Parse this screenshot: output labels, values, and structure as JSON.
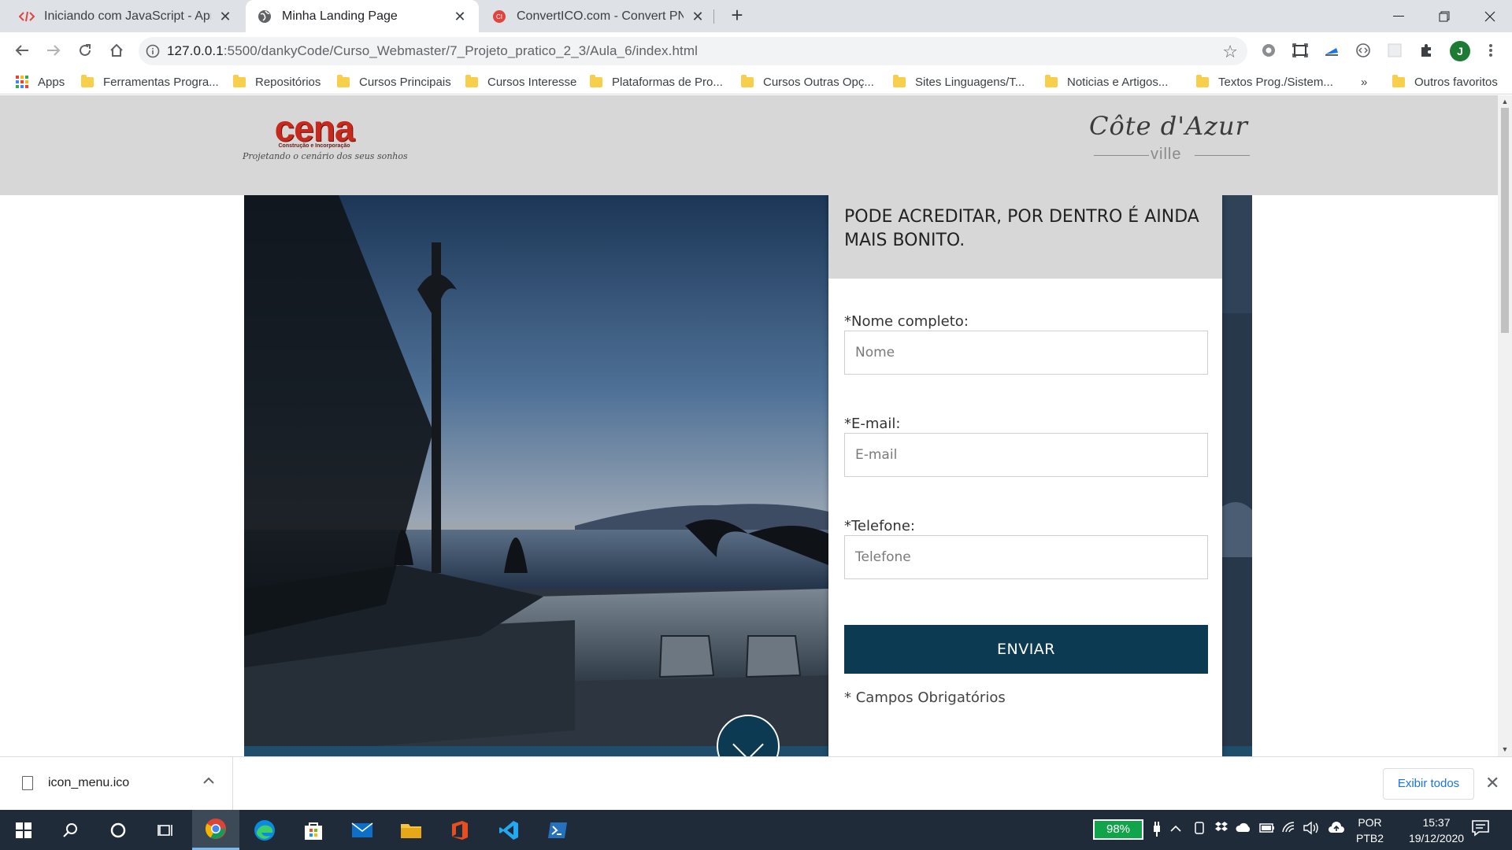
{
  "browser": {
    "tabs": [
      {
        "title": "Iniciando com JavaScript - Apres",
        "active": false
      },
      {
        "title": "Minha Landing Page",
        "active": true
      },
      {
        "title": "ConvertICO.com - Convert PNG t",
        "active": false
      }
    ],
    "new_tab_label": "+",
    "url": {
      "host": "127.0.0.1",
      "path": ":5500/dankyCode/Curso_Webmaster/7_Projeto_pratico_2_3/Aula_6/index.html"
    },
    "profile_initial": "J",
    "bookmarks": [
      {
        "label": "Apps",
        "icon": "apps-grid-icon"
      },
      {
        "label": "Ferramentas Progra...",
        "icon": "folder-icon"
      },
      {
        "label": "Repositórios",
        "icon": "folder-icon"
      },
      {
        "label": "Cursos Principais",
        "icon": "folder-icon"
      },
      {
        "label": "Cursos Interesse",
        "icon": "folder-icon"
      },
      {
        "label": "Plataformas de Pro...",
        "icon": "folder-icon"
      },
      {
        "label": "Cursos Outras Opç...",
        "icon": "folder-icon"
      },
      {
        "label": "Sites Linguagens/T...",
        "icon": "folder-icon"
      },
      {
        "label": "Noticias e Artigos...",
        "icon": "folder-icon"
      },
      {
        "label": "Textos Prog./Sistem...",
        "icon": "folder-icon"
      }
    ],
    "bookmarks_overflow": "»",
    "other_bookmarks": "Outros favoritos"
  },
  "page": {
    "logo_left": {
      "word": "cena",
      "sub": "Construção e Incorporação",
      "slogan": "Projetando o cenário dos seus sonhos"
    },
    "logo_right": {
      "script": "Côte d'Azur",
      "sub": "ville"
    },
    "form": {
      "heading": "PODE ACREDITAR, POR DENTRO É AINDA MAIS BONITO.",
      "name_label": "*Nome completo:",
      "name_placeholder": "Nome",
      "email_label": "*E-mail:",
      "email_placeholder": "E-mail",
      "phone_label": "*Telefone:",
      "phone_placeholder": "Telefone",
      "submit_label": "ENVIAR",
      "required_note": "* Campos Obrigatórios"
    },
    "colors": {
      "brand_dark": "#0b3a52",
      "header_bg": "#d7d7d7",
      "logo_red": "#c72a1c"
    }
  },
  "downloads": {
    "file_name": "icon_menu.ico",
    "show_all": "Exibir todos"
  },
  "taskbar": {
    "battery": "98%",
    "lang_top": "POR",
    "lang_bottom": "PTB2",
    "time": "15:37",
    "date": "19/12/2020"
  }
}
